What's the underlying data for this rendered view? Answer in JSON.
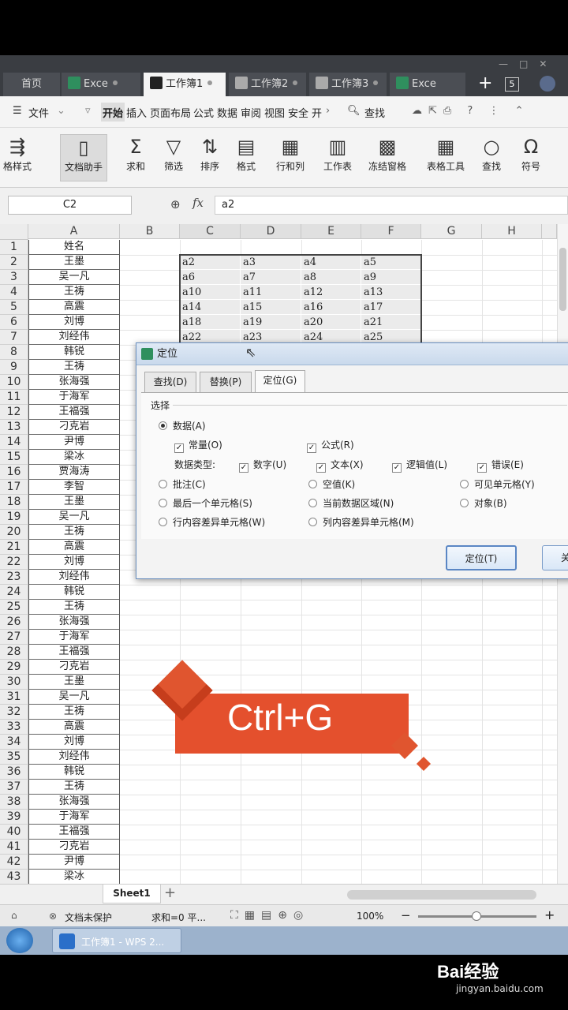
{
  "tabs": [
    {
      "label": "首页",
      "icon": "none"
    },
    {
      "label": "Exce",
      "icon": "sheet-icon"
    },
    {
      "label": "工作簿1",
      "icon": "sheet-icon"
    },
    {
      "label": "工作簿2",
      "icon": "doc-icon"
    },
    {
      "label": "工作簿3",
      "icon": "doc-icon"
    },
    {
      "label": "Exce",
      "icon": "sheet-icon"
    }
  ],
  "tab_count": "5",
  "menu": {
    "file": "文件",
    "items": [
      "开始",
      "插入",
      "页面布局",
      "公式",
      "数据",
      "审阅",
      "视图",
      "安全",
      "开"
    ],
    "find": "查找"
  },
  "ribbon": [
    "格样式",
    "文档助手",
    "求和",
    "筛选",
    "排序",
    "格式",
    "行和列",
    "工作表",
    "冻结窗格",
    "表格工具",
    "查找",
    "符号"
  ],
  "formula": {
    "namebox": "C2",
    "fx": "fx",
    "value": "a2"
  },
  "columns": [
    "A",
    "B",
    "C",
    "D",
    "E",
    "F",
    "G",
    "H"
  ],
  "col_a": [
    "姓名",
    "王墨",
    "吴一凡",
    "王祷",
    "高震",
    "刘博",
    "刘经伟",
    "韩锐",
    "王祷",
    "张海强",
    "于海军",
    "王福强",
    "刁克岩",
    "尹博",
    "梁冰",
    "贾海涛",
    "李智",
    "王墨",
    "吴一凡",
    "王祷",
    "高震",
    "刘博",
    "刘经伟",
    "韩锐",
    "王祷",
    "张海强",
    "于海军",
    "王福强",
    "刁克岩",
    "王墨",
    "吴一凡",
    "王祷",
    "高震",
    "刘博",
    "刘经伟",
    "韩锐",
    "王祷",
    "张海强",
    "于海军",
    "王福强",
    "刁克岩",
    "尹博",
    "梁冰"
  ],
  "data_cells": [
    [
      "a2",
      "a3",
      "a4",
      "a5"
    ],
    [
      "a6",
      "a7",
      "a8",
      "a9"
    ],
    [
      "a10",
      "a11",
      "a12",
      "a13"
    ],
    [
      "a14",
      "a15",
      "a16",
      "a17"
    ],
    [
      "a18",
      "a19",
      "a20",
      "a21"
    ],
    [
      "a22",
      "a23",
      "a24",
      "a25"
    ]
  ],
  "dialog": {
    "title": "定位",
    "tabs": [
      "查找(D)",
      "替换(P)",
      "定位(G)"
    ],
    "section": "选择",
    "data": "数据(A)",
    "constant": "常量(O)",
    "formula": "公式(R)",
    "data_type": "数据类型:",
    "number": "数字(U)",
    "text": "文本(X)",
    "logical": "逻辑值(L)",
    "error": "错误(E)",
    "comment": "批注(C)",
    "blank": "空值(K)",
    "visible": "可见单元格(Y)",
    "last_cell": "最后一个单元格(S)",
    "current_region": "当前数据区域(N)",
    "object": "对象(B)",
    "row_diff": "行内容差异单元格(W)",
    "col_diff": "列内容差异单元格(M)",
    "goto_btn": "定位(T)",
    "close_btn": "关"
  },
  "overlay": "Ctrl+G",
  "sheet": "Sheet1",
  "status": {
    "protect": "文档未保护",
    "sum": "求和=0  平...",
    "zoom": "100%"
  },
  "taskbar": "工作簿1 - WPS 2...",
  "watermark": {
    "brand": "Bai经验",
    "url": "jingyan.baidu.com"
  },
  "colors": {
    "overlay": "#e4502d",
    "accent": "#2f8f5e"
  }
}
